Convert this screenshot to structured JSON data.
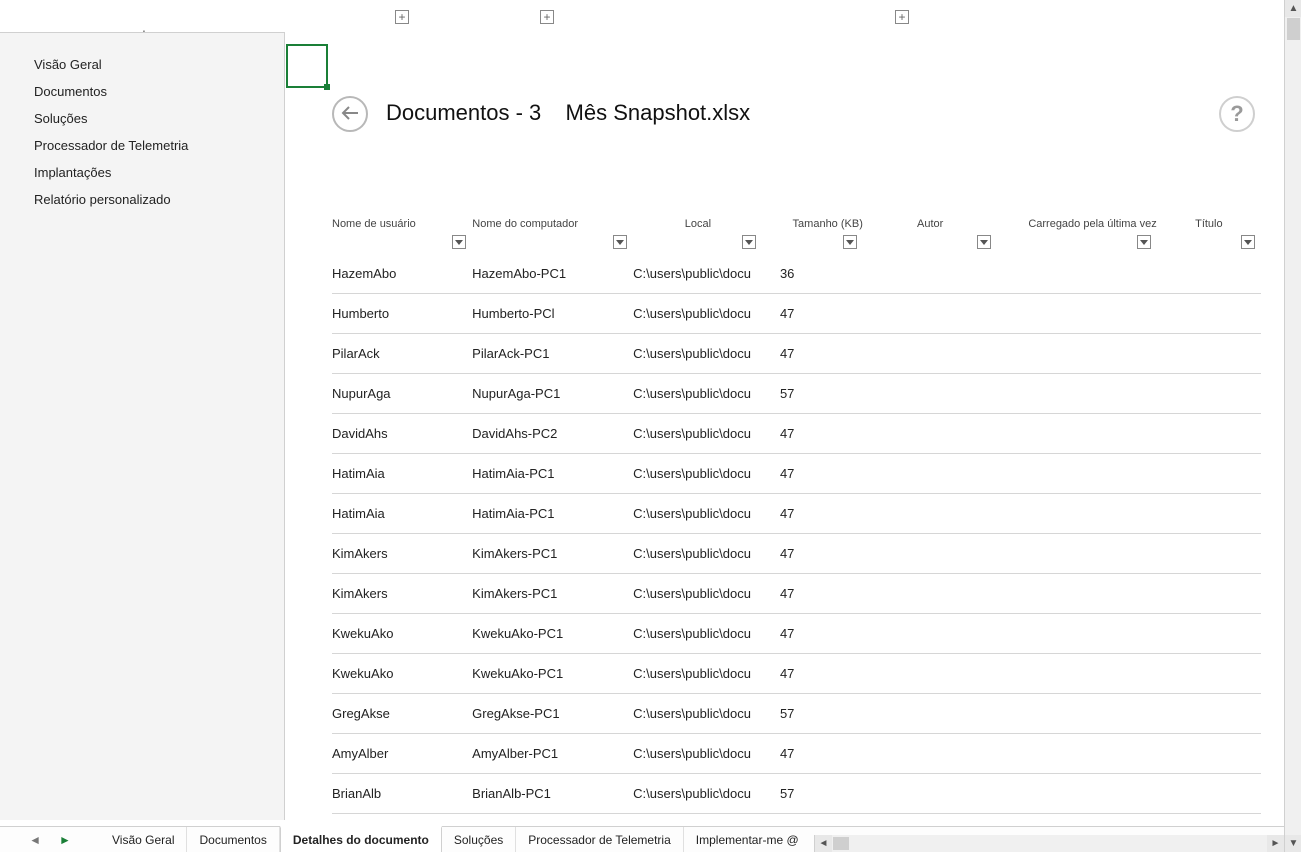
{
  "sidebar": {
    "items": [
      {
        "label": "Visão Geral"
      },
      {
        "label": "Documentos"
      },
      {
        "label": "Soluções"
      },
      {
        "label": "Processador de Telemetria"
      },
      {
        "label": "Implantações"
      },
      {
        "label": "Relatório personalizado"
      }
    ]
  },
  "title": {
    "prefix": "Documentos - 3",
    "filename": "Mês Snapshot.xlsx"
  },
  "columns": {
    "c0": "Nome de usuário",
    "c1": "Nome do computador",
    "c2": "Local",
    "c3": "Tamanho (KB)",
    "c4": "Autor",
    "c5": "Carregado pela última vez",
    "c6": "Título"
  },
  "rows": [
    {
      "user": "HazemAbo",
      "pc": "HazemAbo-PC1",
      "loc": "C:\\users\\public\\docu",
      "size": "36"
    },
    {
      "user": "Humberto",
      "pc": "Humberto-PCl",
      "loc": "C:\\users\\public\\docu",
      "size": "47"
    },
    {
      "user": "PilarAck",
      "pc": "PilarAck-PC1",
      "loc": "C:\\users\\public\\docu",
      "size": "47"
    },
    {
      "user": "NupurAga",
      "pc": "NupurAga-PC1",
      "loc": "C:\\users\\public\\docu",
      "size": "57"
    },
    {
      "user": "DavidAhs",
      "pc": "DavidAhs-PC2",
      "loc": "C:\\users\\public\\docu",
      "size": "47"
    },
    {
      "user": "HatimAia",
      "pc": "HatimAia-PC1",
      "loc": "C:\\users\\public\\docu",
      "size": "47"
    },
    {
      "user": "HatimAia",
      "pc": "HatimAia-PC1",
      "loc": "C:\\users\\public\\docu",
      "size": "47"
    },
    {
      "user": "KimAkers",
      "pc": "KimAkers-PC1",
      "loc": "C:\\users\\public\\docu",
      "size": "47"
    },
    {
      "user": "KimAkers",
      "pc": "KimAkers-PC1",
      "loc": "C:\\users\\public\\docu",
      "size": "47"
    },
    {
      "user": "KwekuAko",
      "pc": "KwekuAko-PC1",
      "loc": "C:\\users\\public\\docu",
      "size": "47"
    },
    {
      "user": "KwekuAko",
      "pc": "KwekuAko-PC1",
      "loc": "C:\\users\\public\\docu",
      "size": "47"
    },
    {
      "user": "GregAkse",
      "pc": "GregAkse-PC1",
      "loc": "C:\\users\\public\\docu",
      "size": "57"
    },
    {
      "user": "AmyAlber",
      "pc": "AmyAlber-PC1",
      "loc": "C:\\users\\public\\docu",
      "size": "47"
    },
    {
      "user": "BrianAlb",
      "pc": "BrianAlb-PC1",
      "loc": "C:\\users\\public\\docu",
      "size": "57"
    }
  ],
  "tabs": [
    {
      "label": "Visão Geral",
      "active": false
    },
    {
      "label": "Documentos",
      "active": false
    },
    {
      "label": "Detalhes do documento",
      "active": true
    },
    {
      "label": "Soluções",
      "active": false
    },
    {
      "label": "Processador de Telemetria",
      "active": false
    },
    {
      "label": "Implementar-me @",
      "active": false
    }
  ]
}
